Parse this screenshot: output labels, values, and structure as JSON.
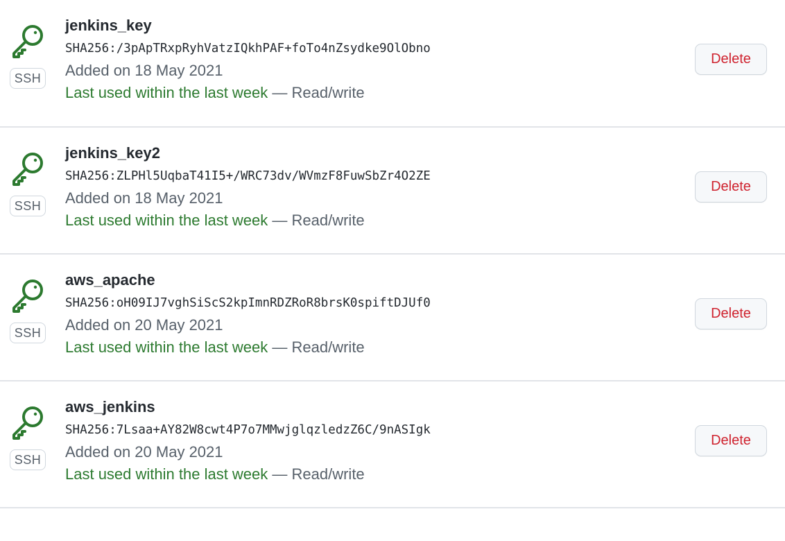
{
  "colors": {
    "key_icon": "#2c7a2f",
    "last_used": "#2c7a2f",
    "delete_text": "#cf222e"
  },
  "keys": [
    {
      "title": "jenkins_key",
      "type_badge": "SSH",
      "fingerprint": "SHA256:/3pApTRxpRyhVatzIQkhPAF+foTo4nZsydke9OlObno",
      "added": "Added on 18 May 2021",
      "last_used": "Last used within the last week",
      "access": " — Read/write",
      "delete_label": "Delete",
      "icon": "key-icon"
    },
    {
      "title": "jenkins_key2",
      "type_badge": "SSH",
      "fingerprint": "SHA256:ZLPHl5UqbaT41I5+/WRC73dv/WVmzF8FuwSbZr4O2ZE",
      "added": "Added on 18 May 2021",
      "last_used": "Last used within the last week",
      "access": " — Read/write",
      "delete_label": "Delete",
      "icon": "key-icon"
    },
    {
      "title": "aws_apache",
      "type_badge": "SSH",
      "fingerprint": "SHA256:oH09IJ7vghSiScS2kpImnRDZRoR8brsK0spiftDJUf0",
      "added": "Added on 20 May 2021",
      "last_used": "Last used within the last week",
      "access": " — Read/write",
      "delete_label": "Delete",
      "icon": "key-icon"
    },
    {
      "title": "aws_jenkins",
      "type_badge": "SSH",
      "fingerprint": "SHA256:7Lsaa+AY82W8cwt4P7o7MMwjglqzledzZ6C/9nASIgk",
      "added": "Added on 20 May 2021",
      "last_used": "Last used within the last week",
      "access": " — Read/write",
      "delete_label": "Delete",
      "icon": "key-icon"
    }
  ]
}
